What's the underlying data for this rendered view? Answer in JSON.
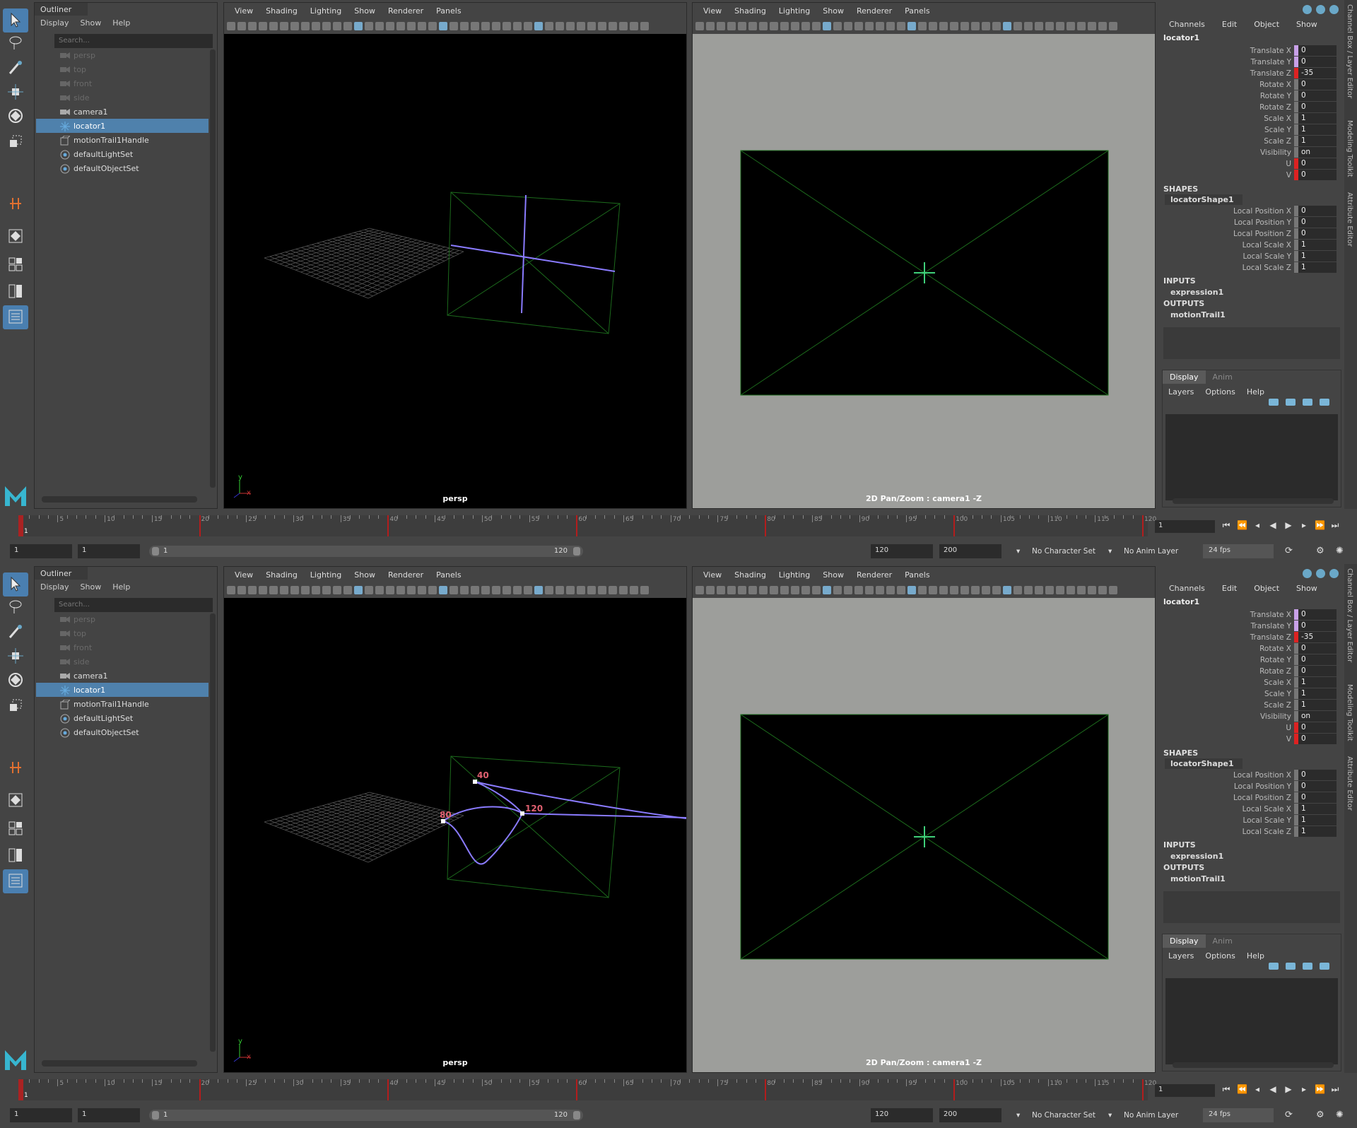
{
  "outliner": {
    "tab": "Outliner",
    "menu": [
      "Display",
      "Show",
      "Help"
    ],
    "search_placeholder": "Search...",
    "items": [
      {
        "label": "persp",
        "dim": true
      },
      {
        "label": "top",
        "dim": true
      },
      {
        "label": "front",
        "dim": true
      },
      {
        "label": "side",
        "dim": true
      },
      {
        "label": "camera1",
        "dim": false
      },
      {
        "label": "locator1",
        "selected": true
      },
      {
        "label": "motionTrail1Handle",
        "dim": false
      },
      {
        "label": "defaultLightSet",
        "dim": false
      },
      {
        "label": "defaultObjectSet",
        "dim": false
      }
    ]
  },
  "viewport_menu": [
    "View",
    "Shading",
    "Lighting",
    "Show",
    "Renderer",
    "Panels"
  ],
  "left_viewport": {
    "label": "persp"
  },
  "right_viewport": {
    "label": "2D Pan/Zoom : camera1 -Z"
  },
  "motion_trail_labels": [
    "40",
    "80",
    "120"
  ],
  "axis_labels": {
    "y": "y",
    "x": "x"
  },
  "channel_box": {
    "menu": [
      "Channels",
      "Edit",
      "Object",
      "Show"
    ],
    "object": "locator1",
    "attributes": [
      {
        "label": "Translate X",
        "value": "0",
        "key": "k"
      },
      {
        "label": "Translate Y",
        "value": "0",
        "key": "k"
      },
      {
        "label": "Translate Z",
        "value": "-35",
        "key": "r"
      },
      {
        "label": "Rotate X",
        "value": "0",
        "key": ""
      },
      {
        "label": "Rotate Y",
        "value": "0",
        "key": ""
      },
      {
        "label": "Rotate Z",
        "value": "0",
        "key": ""
      },
      {
        "label": "Scale X",
        "value": "1",
        "key": ""
      },
      {
        "label": "Scale Y",
        "value": "1",
        "key": ""
      },
      {
        "label": "Scale Z",
        "value": "1",
        "key": ""
      },
      {
        "label": "Visibility",
        "value": "on",
        "key": ""
      },
      {
        "label": "U",
        "value": "0",
        "key": "r"
      },
      {
        "label": "V",
        "value": "0",
        "key": "r"
      }
    ],
    "shapes_header": "SHAPES",
    "shape_name": "locatorShape1",
    "shape_attributes": [
      {
        "label": "Local Position X",
        "value": "0"
      },
      {
        "label": "Local Position Y",
        "value": "0"
      },
      {
        "label": "Local Position Z",
        "value": "0"
      },
      {
        "label": "Local Scale X",
        "value": "1"
      },
      {
        "label": "Local Scale Y",
        "value": "1"
      },
      {
        "label": "Local Scale Z",
        "value": "1"
      }
    ],
    "inputs_header": "INPUTS",
    "input": "expression1",
    "outputs_header": "OUTPUTS",
    "output": "motionTrail1"
  },
  "layer_editor": {
    "tabs": [
      "Display",
      "Anim"
    ],
    "menu": [
      "Layers",
      "Options",
      "Help"
    ]
  },
  "side_tabs": [
    "Channel Box / Layer Editor",
    "Modeling Toolkit",
    "Attribute Editor"
  ],
  "timeline": {
    "ticks": [
      "5",
      "10",
      "15",
      "20",
      "25",
      "30",
      "35",
      "40",
      "45",
      "50",
      "55",
      "60",
      "65",
      "70",
      "75",
      "80",
      "85",
      "90",
      "95",
      "100",
      "105",
      "110",
      "115",
      "120"
    ],
    "keys": [
      20,
      40,
      60,
      80,
      100,
      120
    ],
    "current_frame": "1"
  },
  "range": {
    "start": "1",
    "playback_start": "1",
    "slider_start": "1",
    "slider_end": "120",
    "playback_end": "120",
    "end": "200",
    "character_set": "No Character Set",
    "anim_layer": "No Anim Layer",
    "fps": "24 fps"
  },
  "colors": {
    "accent": "#4f81ac",
    "key_red": "#b31d1d",
    "trail": "#8a7bff",
    "camera_green": "#2a7a2a"
  }
}
